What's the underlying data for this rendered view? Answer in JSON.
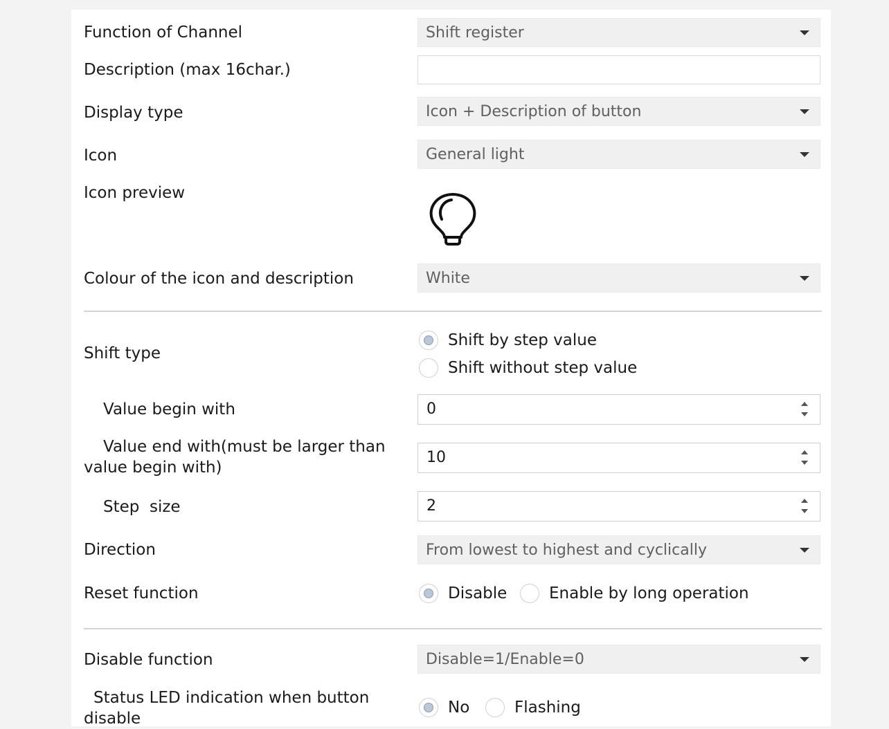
{
  "function_of_channel": {
    "label": "Function of Channel",
    "value": "Shift register"
  },
  "description": {
    "label": "Description (max 16char.)",
    "value": ""
  },
  "display_type": {
    "label": "Display type",
    "value": "Icon + Description of button"
  },
  "icon": {
    "label": "Icon",
    "value": "General light"
  },
  "icon_preview": {
    "label": "Icon preview",
    "icon": "light-bulb-icon"
  },
  "colour": {
    "label": "Colour of the icon and description",
    "value": "White"
  },
  "shift_type": {
    "label": "Shift type",
    "options": [
      "Shift by step value",
      "Shift without step value"
    ],
    "selected": 0
  },
  "value_begin": {
    "label": "Value begin with",
    "value": "0"
  },
  "value_end": {
    "label": "Value end with(must be larger than value begin with)",
    "value": "10"
  },
  "step_size": {
    "label": "Step  size",
    "value": "2"
  },
  "direction": {
    "label": "Direction",
    "value": "From lowest to highest and cyclically"
  },
  "reset_function": {
    "label": "Reset function",
    "options": [
      "Disable",
      "Enable by long operation"
    ],
    "selected": 0
  },
  "disable_function": {
    "label": "Disable function",
    "value": "Disable=1/Enable=0"
  },
  "status_led": {
    "label": "Status LED indication when button disable",
    "options": [
      "No",
      "Flashing"
    ],
    "selected": 0
  }
}
